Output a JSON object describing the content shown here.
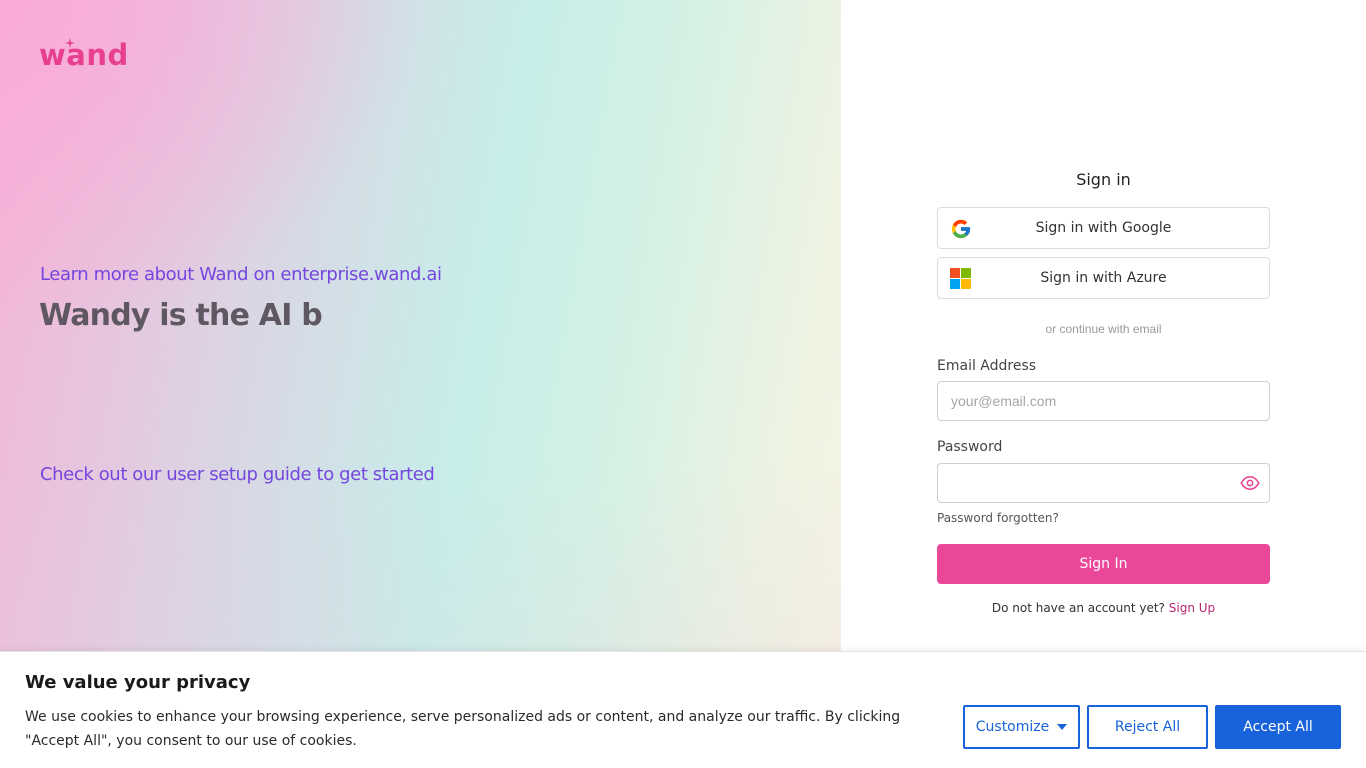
{
  "brand": {
    "logo_text": "wand",
    "accent": "#e83f8e"
  },
  "promo": {
    "link_top": "Learn more about Wand on enterprise.wand.ai",
    "headline": "Wandy is the AI b",
    "link_bottom": "Check out our user setup guide to get started",
    "link_color": "#7446df"
  },
  "signin": {
    "title": "Sign in",
    "google_label": "Sign in with Google",
    "google_icon": "google-icon",
    "azure_label": "Sign in with Azure",
    "azure_icon": "microsoft-icon",
    "divider": "or continue with email",
    "email_label": "Email Address",
    "email_placeholder": "your@email.com",
    "email_value": "",
    "password_label": "Password",
    "password_value": "",
    "password_toggle_icon": "eye-icon",
    "forgot_label": "Password forgotten?",
    "submit_label": "Sign In",
    "submit_color": "#ea4799",
    "no_account_text": "Do not have an account yet?",
    "signup_label": "Sign Up"
  },
  "cookie_banner": {
    "title": "We value your privacy",
    "text": "We use cookies to enhance your browsing experience, serve personalized ads or content, and analyze our traffic. By clicking \"Accept All\", you consent to our use of cookies.",
    "customize_label": "Customize",
    "reject_label": "Reject All",
    "accept_label": "Accept All",
    "button_color": "#1863dc"
  }
}
